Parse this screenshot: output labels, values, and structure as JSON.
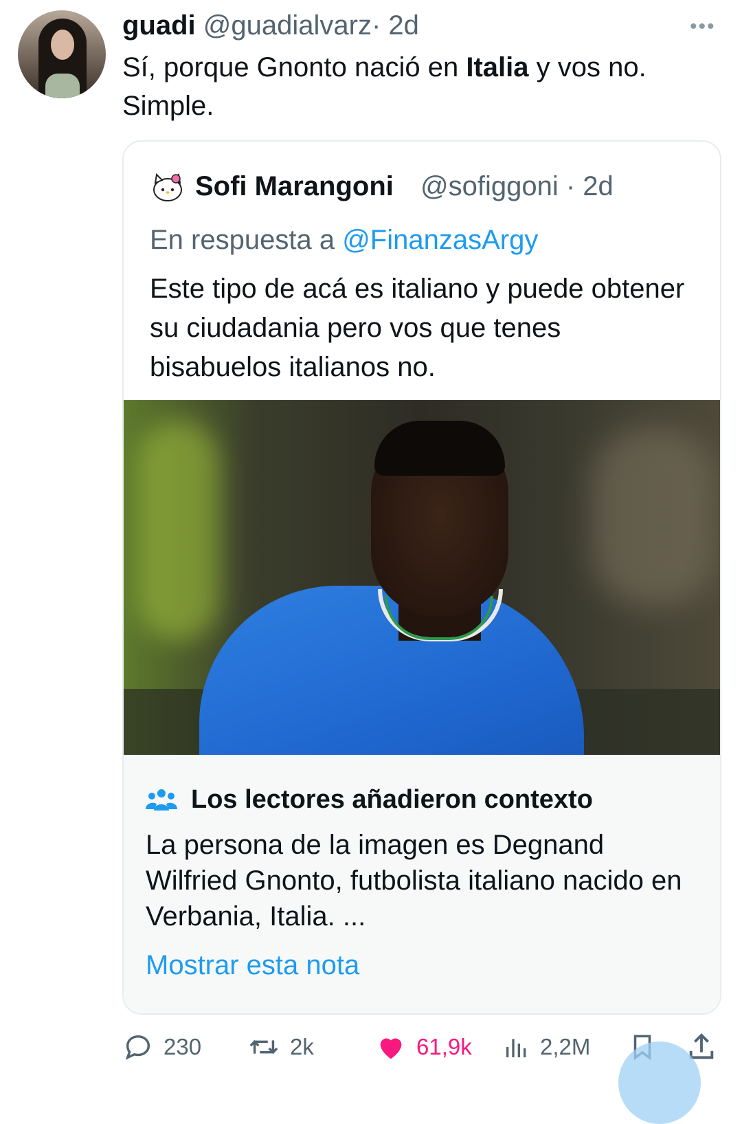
{
  "tweet": {
    "display_name": "guadi",
    "handle": "@guadialvarz",
    "time": "· 2d",
    "more_label": "•••",
    "text_before": "Sí, porque Gnonto nació en ",
    "text_bold": "Italia",
    "text_after": " y vos no. Simple."
  },
  "quoted": {
    "display_name": "Sofi Marangoni",
    "handle": "@sofiggoni · 2d",
    "reply_prefix": "En respuesta a ",
    "reply_to": "@FinanzasArgy",
    "text": "Este tipo de acá es italiano y puede obtener su ciudadania pero vos que tenes bisabuelos italianos no.",
    "image_alt": "football-player-photo"
  },
  "community_note": {
    "title": "Los lectores añadieron contexto",
    "text": "La persona de la imagen es Degnand Wilfried Gnonto, futbolista italiano nacido en Verbania, Italia. ...",
    "link": "Mostrar esta nota"
  },
  "actions": {
    "replies": "230",
    "retweets": "2k",
    "likes": "61,9k",
    "views": "2,2M"
  },
  "colors": {
    "accent": "#1d9bf0",
    "like": "#f91880",
    "muted": "#536471",
    "text": "#0f1419"
  },
  "icons": [
    "more-icon",
    "community-icon",
    "reply-icon",
    "retweet-icon",
    "heart-icon",
    "views-icon",
    "bookmark-icon",
    "share-icon"
  ]
}
